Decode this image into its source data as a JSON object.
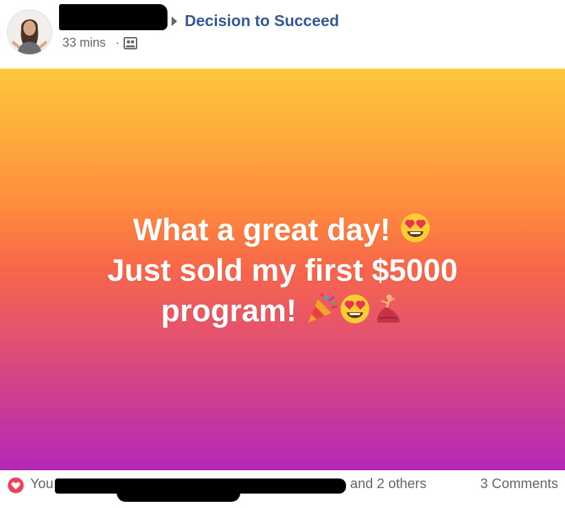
{
  "post": {
    "group_name": "Decision to Succeed",
    "timestamp": "33 mins",
    "separator": "·",
    "audience_icon": "group-audience-icon",
    "background_colors": [
      "#fdc83c",
      "#fe8a3d",
      "#f7664a",
      "#df4e77",
      "#b227b7"
    ],
    "text_lines": [
      "What a great day!",
      "Just sold my first $5000",
      "program!"
    ],
    "emojis": [
      "heart-eyes-emoji",
      "party-popper-emoji",
      "heart-eyes-emoji",
      "dancer-emoji"
    ]
  },
  "footer": {
    "reaction_icon": "love-reaction-icon",
    "reaction_color": "#f33e58",
    "likes_prefix": "You,",
    "likes_suffix": "and 2 others",
    "comments_label": "3 Comments"
  },
  "colors": {
    "link_blue": "#365899",
    "secondary_text": "#616770"
  }
}
